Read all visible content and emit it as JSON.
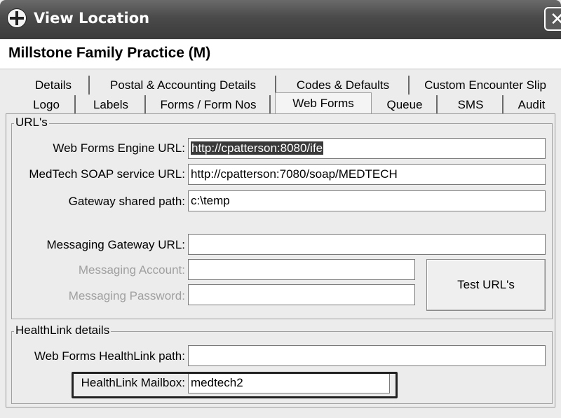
{
  "window": {
    "title": "View Location",
    "close_glyph": "✕"
  },
  "practice_name": "Millstone Family Practice (M)",
  "tabs": {
    "row1": [
      "Details",
      "Postal & Accounting Details",
      "Codes & Defaults",
      "Custom Encounter Slip"
    ],
    "row2": [
      "Logo",
      "Labels",
      "Forms / Form Nos",
      "Web Forms",
      "Queue",
      "SMS",
      "Audit"
    ],
    "active": "Web Forms"
  },
  "urls_group": {
    "title": "URL's",
    "web_forms_engine": {
      "label": "Web Forms Engine URL:",
      "value": "http://cpatterson:8080/ife"
    },
    "medtech_soap": {
      "label": "MedTech SOAP service URL:",
      "value": "http://cpatterson:7080/soap/MEDTECH"
    },
    "gateway_path": {
      "label": "Gateway shared path:",
      "value": "c:\\temp"
    },
    "messaging_gateway": {
      "label": "Messaging Gateway URL:",
      "value": ""
    },
    "messaging_account": {
      "label": "Messaging Account:",
      "value": ""
    },
    "messaging_password": {
      "label": "Messaging Password:",
      "value": ""
    },
    "test_button": "Test URL's"
  },
  "healthlink_group": {
    "title": "HealthLink details",
    "web_forms_path": {
      "label": "Web Forms HealthLink path:",
      "value": ""
    },
    "mailbox": {
      "label": "HealthLink Mailbox:",
      "value": "medtech2"
    }
  }
}
